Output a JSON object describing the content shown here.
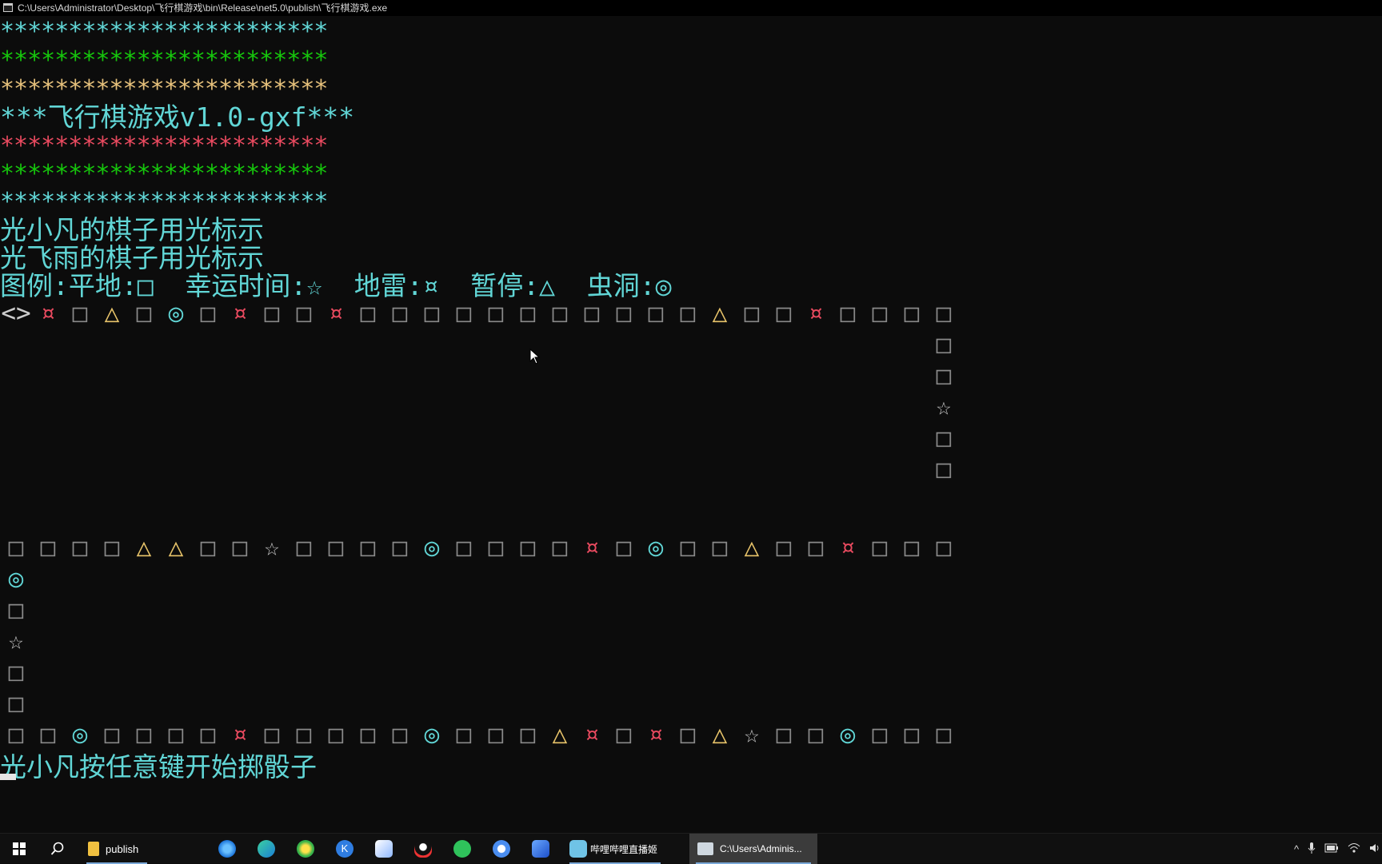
{
  "window": {
    "title": "C:\\Users\\Administrator\\Desktop\\飞行棋游戏\\bin\\Release\\net5.0\\publish\\飞行棋游戏.exe"
  },
  "header": {
    "star_row": "************************",
    "game_title": "***飞行棋游戏v1.0-gxf***",
    "colors": {
      "cyan": "#61d6d6",
      "green": "#16c60c",
      "yellow": "#e5c07b",
      "red": "#e84a5f"
    }
  },
  "players": {
    "a_line": "光小凡的棋子用光标示",
    "b_line": "光飞雨的棋子用光标示"
  },
  "legend": {
    "text": "图例:平地:□  幸运时间:☆  地雷:¤  暂停:△  虫洞:◎"
  },
  "map": {
    "glyphs": {
      "sq": "□",
      "hole": "¤",
      "pause": "△",
      "worm": "◎",
      "lucky": "☆",
      "player": "<>"
    },
    "row1": [
      "player",
      "hole",
      "sq",
      "pause",
      "sq",
      "worm",
      "sq",
      "hole",
      "sq",
      "sq",
      "hole",
      "sq",
      "sq",
      "sq",
      "sq",
      "sq",
      "sq",
      "sq",
      "sq",
      "sq",
      "sq",
      "sq",
      "pause",
      "sq",
      "sq",
      "hole",
      "sq",
      "sq",
      "sq",
      "sq"
    ],
    "right_col": [
      "sq",
      "sq",
      "lucky",
      "sq",
      "sq"
    ],
    "row2": [
      "sq",
      "sq",
      "sq",
      "sq",
      "pause",
      "pause",
      "sq",
      "sq",
      "lucky",
      "sq",
      "sq",
      "sq",
      "sq",
      "worm",
      "sq",
      "sq",
      "sq",
      "sq",
      "hole",
      "sq",
      "worm",
      "sq",
      "sq",
      "pause",
      "sq",
      "sq",
      "hole",
      "sq",
      "sq",
      "sq"
    ],
    "left_col": [
      "worm",
      "sq",
      "lucky",
      "sq",
      "sq"
    ],
    "row3": [
      "sq",
      "sq",
      "worm",
      "sq",
      "sq",
      "sq",
      "sq",
      "hole",
      "sq",
      "sq",
      "sq",
      "sq",
      "sq",
      "worm",
      "sq",
      "sq",
      "sq",
      "pause",
      "hole",
      "sq",
      "hole",
      "sq",
      "pause",
      "lucky",
      "sq",
      "sq",
      "worm",
      "sq",
      "sq",
      "sq"
    ]
  },
  "prompt": {
    "text": "光小凡按任意键开始掷骰子"
  },
  "taskbar": {
    "explorer_label": "publish",
    "live_label": "哔哩哔哩直播姬",
    "console_label": "C:\\Users\\Adminis...",
    "icons": [
      "windows-start-icon",
      "search-icon",
      "file-explorer-icon",
      "browser-q-icon",
      "edge-icon",
      "green-app-icon",
      "k-app-icon",
      "photos-icon",
      "qq-penguin-icon",
      "wechat-icon",
      "blue-bird-icon",
      "feather-icon",
      "bilibili-live-icon",
      "console-icon"
    ]
  }
}
